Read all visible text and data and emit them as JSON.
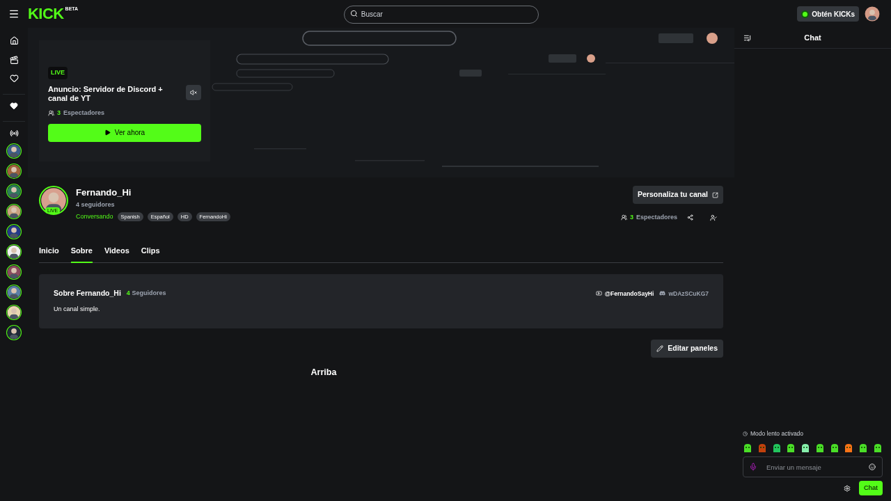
{
  "topbar": {
    "logo": "KICK",
    "logo_badge": "BETA",
    "search": {
      "placeholder": "Buscar"
    },
    "kicks_button": "Obtén KICKs"
  },
  "stream_card": {
    "badge": "LIVE",
    "title": "Anuncio: Servidor de Discord + canal de YT",
    "viewer_count": "3",
    "viewer_label": "Espectadores",
    "watch_button": "Ver ahora"
  },
  "channel": {
    "name": "Fernando_Hi",
    "live_badge": "LIVE",
    "followers": "4 seguidores",
    "category": "Conversando",
    "tags": [
      "Spanish",
      "Español",
      "HD",
      "FernandoHi"
    ],
    "customize_button": "Personaliza tu canal",
    "viewer_count": "3",
    "viewer_label": "Espectadores"
  },
  "tabs": [
    {
      "label": "Inicio",
      "selected": false
    },
    {
      "label": "Sobre",
      "selected": true
    },
    {
      "label": "Videos",
      "selected": false
    },
    {
      "label": "Clips",
      "selected": false
    }
  ],
  "about": {
    "title": "Sobre Fernando_Hi",
    "follower_count": "4",
    "follower_label": "Seguidores",
    "description": "Un canal simple.",
    "links": [
      {
        "kind": "youtube",
        "label": "@FernandoSayHi"
      },
      {
        "kind": "discord",
        "label": "wDAzSCuKG7"
      }
    ]
  },
  "edit_panels_button": "Editar paneles",
  "back_to_top": "Arriba",
  "chat": {
    "title": "Chat",
    "slow_mode": "Modo lento activado",
    "input": {
      "placeholder": "Enviar un mensaje"
    },
    "send_button": "Chat"
  }
}
